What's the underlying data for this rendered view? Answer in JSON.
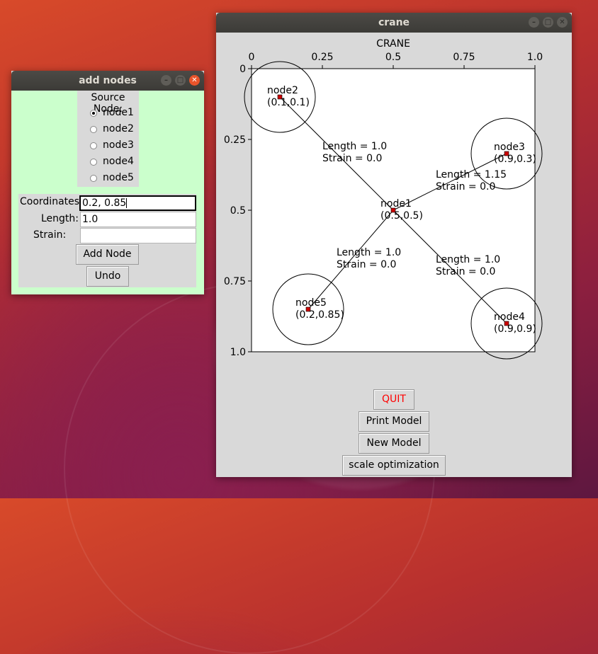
{
  "add_nodes_window": {
    "title": "add nodes",
    "source_node_label": "Source Node:",
    "source_nodes": [
      {
        "label": "node1",
        "selected": true
      },
      {
        "label": "node2",
        "selected": false
      },
      {
        "label": "node3",
        "selected": false
      },
      {
        "label": "node4",
        "selected": false
      },
      {
        "label": "node5",
        "selected": false
      }
    ],
    "coordinates_label": "Coordinates:",
    "coordinates_value": "0.2, 0.85",
    "length_label": "Length:",
    "length_value": "1.0",
    "strain_label": "Strain:",
    "strain_value": "",
    "add_node_button": "Add Node",
    "undo_button": "Undo"
  },
  "crane_window": {
    "title": "crane",
    "plot_title": "CRANE",
    "quit_button": "QUIT",
    "print_model_button": "Print Model",
    "new_model_button": "New Model",
    "scale_optimization_button": "scale optimization",
    "colors": {
      "quit_text": "#ff0000",
      "node_marker": "#cc0000"
    }
  },
  "chart_data": {
    "type": "scatter",
    "title": "CRANE",
    "x_ticks": [
      "0",
      "0.25",
      "0.5",
      "0.75",
      "1.0"
    ],
    "y_ticks": [
      "0",
      "0.25",
      "0.5",
      "0.75",
      "1.0"
    ],
    "xlim": [
      0,
      1
    ],
    "ylim": [
      0,
      1
    ],
    "y_inverted": true,
    "x_axis_position": "top",
    "nodes": [
      {
        "name": "node1",
        "x": 0.5,
        "y": 0.5,
        "label": "node1",
        "coord_label": "(0.5,0.5)",
        "circle": false
      },
      {
        "name": "node2",
        "x": 0.1,
        "y": 0.1,
        "label": "node2",
        "coord_label": "(0.1,0.1)",
        "circle": true
      },
      {
        "name": "node3",
        "x": 0.9,
        "y": 0.3,
        "label": "node3",
        "coord_label": "(0.9,0.3)",
        "circle": true
      },
      {
        "name": "node4",
        "x": 0.9,
        "y": 0.9,
        "label": "node4",
        "coord_label": "(0.9,0.9)",
        "circle": true
      },
      {
        "name": "node5",
        "x": 0.2,
        "y": 0.85,
        "label": "node5",
        "coord_label": "(0.2,0.85)",
        "circle": true
      }
    ],
    "edges": [
      {
        "from": "node1",
        "to": "node2",
        "length_label": "Length = 1.0",
        "strain_label": "Strain = 0.0"
      },
      {
        "from": "node1",
        "to": "node3",
        "length_label": "Length = 1.15",
        "strain_label": "Strain = 0.0"
      },
      {
        "from": "node1",
        "to": "node4",
        "length_label": "Length = 1.0",
        "strain_label": "Strain = 0.0"
      },
      {
        "from": "node1",
        "to": "node5",
        "length_label": "Length = 1.0",
        "strain_label": "Strain = 0.0"
      }
    ]
  }
}
